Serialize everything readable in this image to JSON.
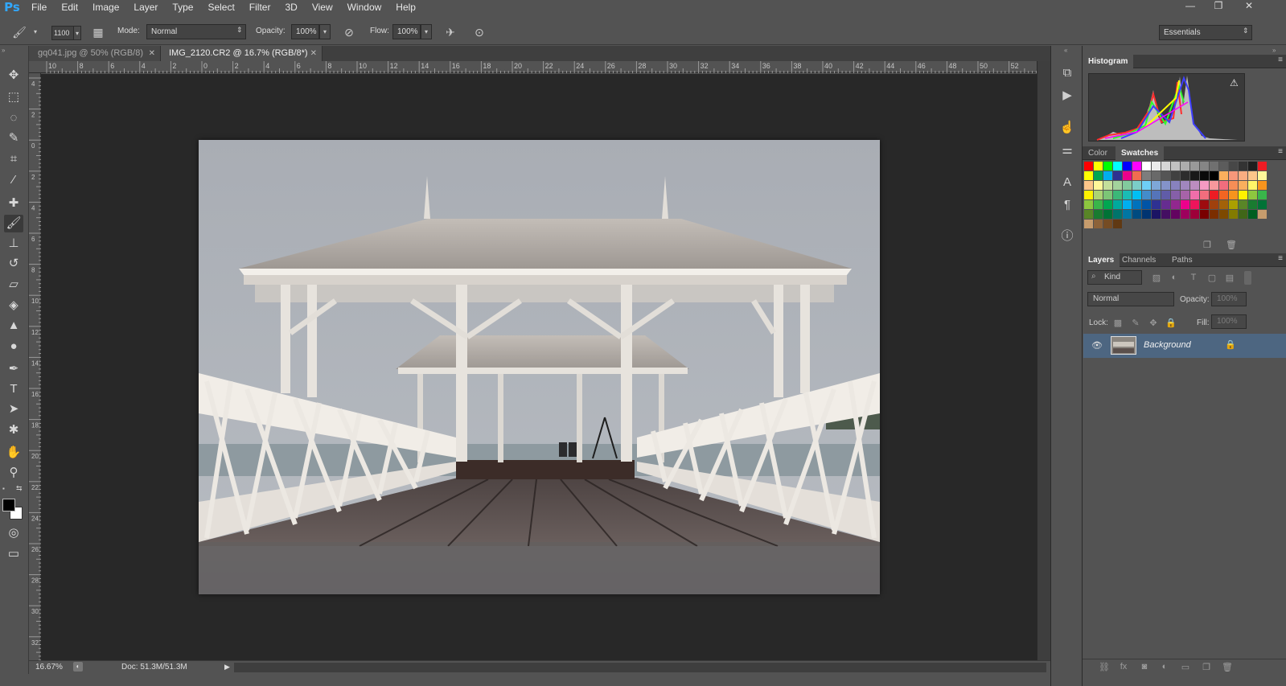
{
  "app": {
    "logo": "Ps"
  },
  "menu": [
    "File",
    "Edit",
    "Image",
    "Layer",
    "Type",
    "Select",
    "Filter",
    "3D",
    "View",
    "Window",
    "Help"
  ],
  "window_controls": {
    "minimize": "—",
    "restore": "❐",
    "close": "✕"
  },
  "options": {
    "brush_size": "1100",
    "mode_label": "Mode:",
    "mode_value": "Normal",
    "opacity_label": "Opacity:",
    "opacity_value": "100%",
    "flow_label": "Flow:",
    "flow_value": "100%",
    "workspace": "Essentials"
  },
  "tabs": [
    {
      "label": "gq041.jpg @ 50% (RGB/8)",
      "active": false
    },
    {
      "label": "IMG_2120.CR2 @ 16.7% (RGB/8*)",
      "active": true
    }
  ],
  "ruler_top": [
    "10",
    "8",
    "6",
    "4",
    "2",
    "0",
    "2",
    "4",
    "6",
    "8",
    "10",
    "12",
    "14",
    "16",
    "18",
    "20",
    "22",
    "24",
    "26",
    "28",
    "30",
    "32",
    "34",
    "36",
    "38",
    "40",
    "42",
    "44",
    "46",
    "48",
    "50",
    "52"
  ],
  "ruler_left": [
    "4",
    "2",
    "0",
    "2",
    "4",
    "6",
    "8",
    "1 0",
    "1 2",
    "1 4",
    "1 6",
    "1 8",
    "2 0",
    "2 2",
    "2 4",
    "2 6",
    "2 8",
    "3 0",
    "3 2"
  ],
  "status": {
    "zoom": "16.67%",
    "doc": "Doc: 51.3M/51.3M"
  },
  "panels": {
    "histogram_tab": "Histogram",
    "histogram_warning": "⚠",
    "color_tab": "Color",
    "swatches_tab": "Swatches",
    "layers_tab": "Layers",
    "channels_tab": "Channels",
    "paths_tab": "Paths",
    "kind_filter": "Kind",
    "blend_mode": "Normal",
    "opacity_label": "Opacity:",
    "opacity_value": "100%",
    "lock_label": "Lock:",
    "fill_label": "Fill:",
    "fill_value": "100%",
    "layer_name": "Background"
  },
  "swatch_colors": [
    [
      "#ff0000",
      "#ffff00",
      "#00ff00",
      "#00ffff",
      "#0000ff",
      "#ff00ff",
      "#ffffff",
      "#ebebeb",
      "#d6d6d6",
      "#c2c2c2",
      "#adadad",
      "#999999",
      "#858585",
      "#707070",
      "#5c5c5c",
      "#474747",
      "#333333",
      "#1f1f1f",
      "#ee1c24"
    ],
    [
      "#ffff00",
      "#00a651",
      "#00aeef",
      "#2e3192",
      "#ec008c",
      "#f26c4f",
      "#7d7d7d",
      "#696969",
      "#555555",
      "#414141",
      "#2d2d2d",
      "#191919",
      "#0a0a0a",
      "#000000",
      "#fbaf5d",
      "#f7977a",
      "#f9ad81",
      "#fdc68a",
      "#fff79a"
    ],
    [
      "#fdc689",
      "#fff799",
      "#c4df9b",
      "#a3d39c",
      "#82ca9d",
      "#7bcdc8",
      "#6ecff6",
      "#7ea7d8",
      "#8493ca",
      "#8882be",
      "#a187be",
      "#bc8dbf",
      "#f49ac2",
      "#f6989d",
      "#f26d7d",
      "#f68e56",
      "#fbaf5d",
      "#fff568",
      "#f7941d"
    ],
    [
      "#fff200",
      "#acd373",
      "#7cc576",
      "#3bb878",
      "#1abbb4",
      "#00bff3",
      "#438ccb",
      "#5574b9",
      "#605ca8",
      "#855fa8",
      "#a763a8",
      "#f06eaa",
      "#f26d7d",
      "#ed1c24",
      "#f26522",
      "#f7941d",
      "#fff200",
      "#8dc63f",
      "#39b54a"
    ],
    [
      "#8dc63f",
      "#39b54a",
      "#00a651",
      "#00a99d",
      "#00aeef",
      "#0072bc",
      "#0054a6",
      "#2e3192",
      "#662d91",
      "#92278f",
      "#ec008c",
      "#ed145b",
      "#9e0b0f",
      "#a0410d",
      "#a36209",
      "#aba000",
      "#598527",
      "#197b30",
      "#007236"
    ],
    [
      "#598527",
      "#197b30",
      "#007236",
      "#00746b",
      "#0076a3",
      "#004b80",
      "#003471",
      "#1b1464",
      "#440e62",
      "#630460",
      "#9e005d",
      "#9e0039",
      "#790000",
      "#7b2e00",
      "#7d4900",
      "#827b00",
      "#406618",
      "#005e20",
      "#c69c6d"
    ],
    [
      "#c69c6d",
      "#8c6239",
      "#754c24",
      "#603913"
    ]
  ]
}
